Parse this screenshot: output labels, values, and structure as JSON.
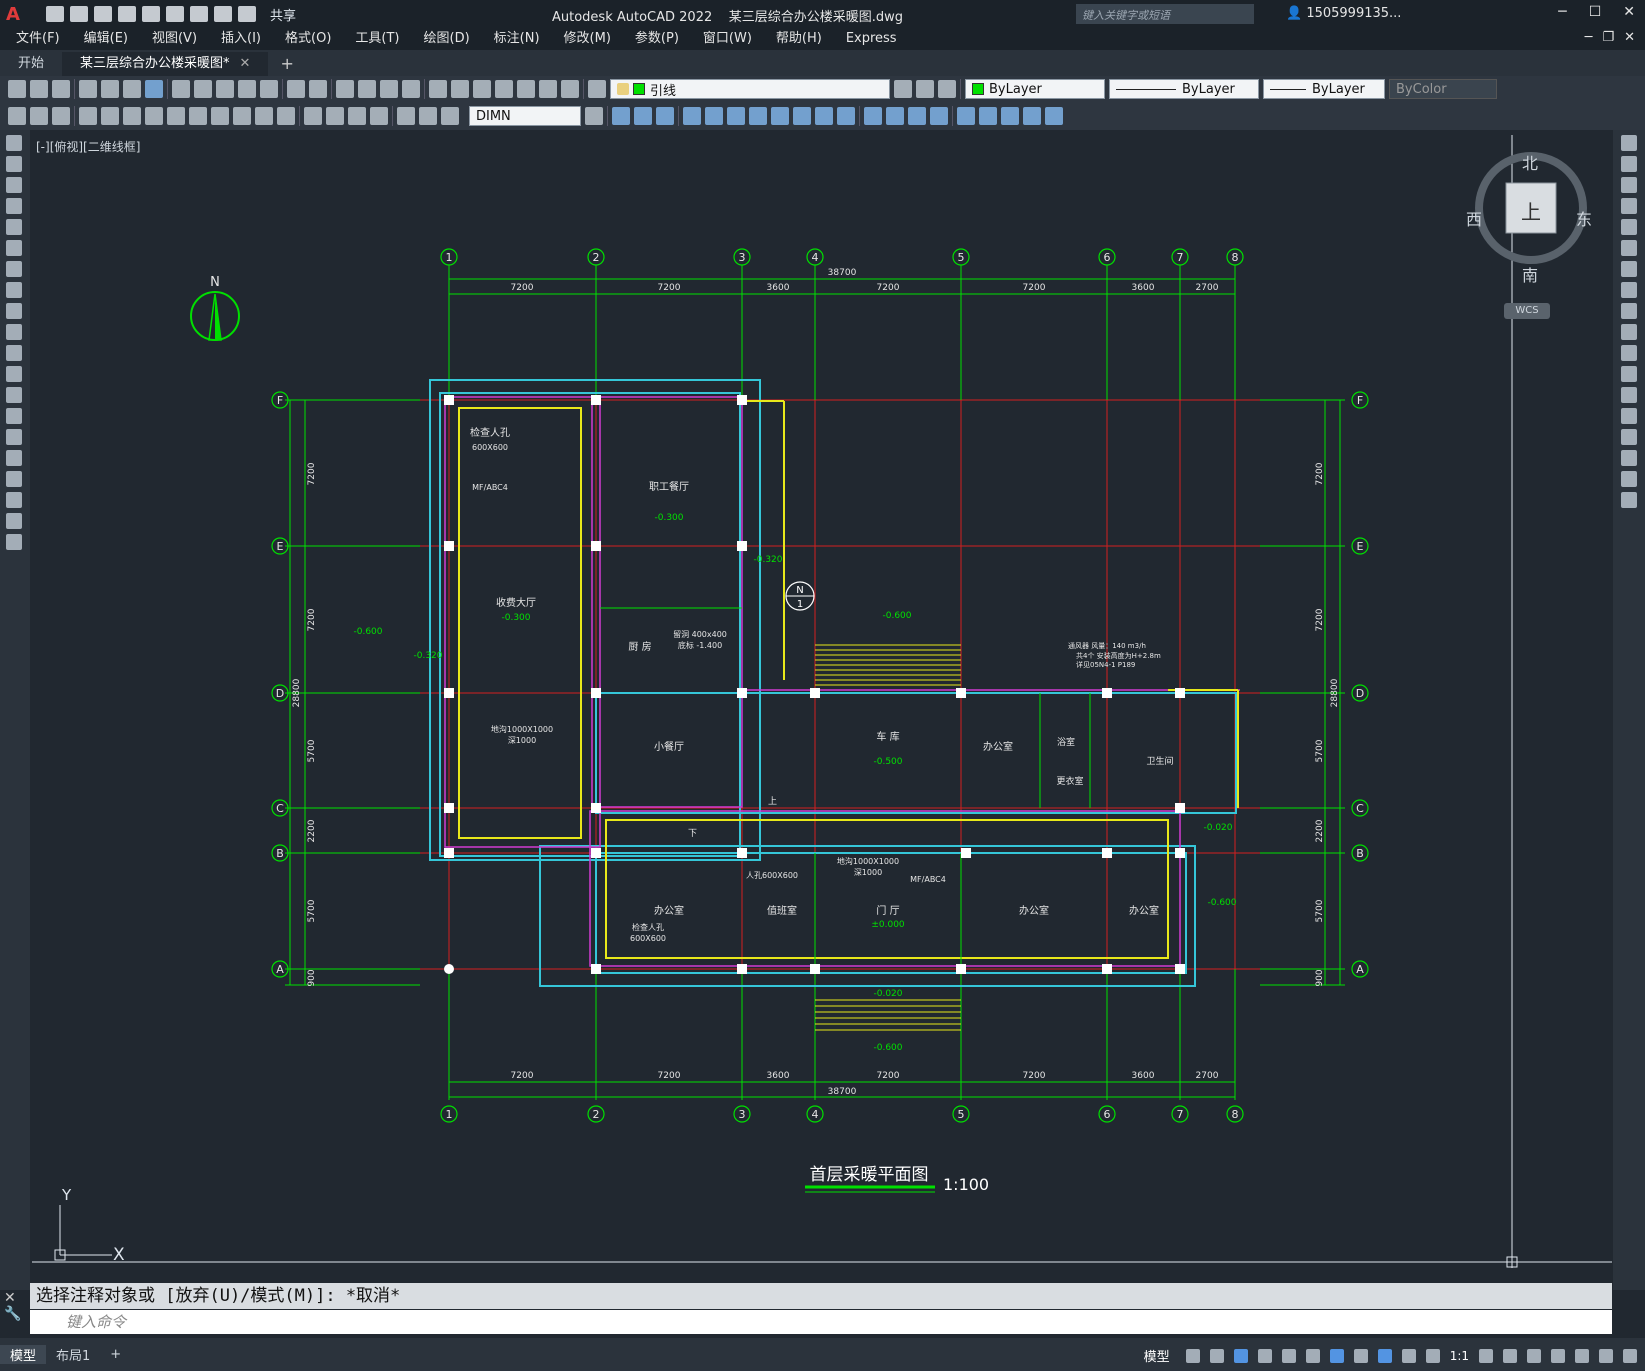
{
  "app": {
    "title": "Autodesk AutoCAD 2022",
    "file": "某三层综合办公楼采暖图.dwg",
    "search_placeholder": "键入关键字或短语",
    "user": "1505999135...",
    "share": "共享"
  },
  "menu": [
    "文件(F)",
    "编辑(E)",
    "视图(V)",
    "插入(I)",
    "格式(O)",
    "工具(T)",
    "绘图(D)",
    "标注(N)",
    "修改(M)",
    "参数(P)",
    "窗口(W)",
    "帮助(H)",
    "Express"
  ],
  "tabs": [
    {
      "label": "开始",
      "active": false
    },
    {
      "label": "某三层综合办公楼采暖图*",
      "active": true
    }
  ],
  "toolbar": {
    "layer": "引线",
    "color": "ByLayer",
    "linetype": "ByLayer",
    "lineweight": "ByLayer",
    "plotstyle": "ByColor",
    "dimstyle": "DIMN"
  },
  "viewport_label": "[-][俯视][二维线框]",
  "viewcube": {
    "north": "北",
    "south": "南",
    "east": "东",
    "west": "西",
    "top": "上",
    "wcs": "WCS"
  },
  "drawing": {
    "title": "首层采暖平面图",
    "scale": "1:100",
    "north_label": "N",
    "axes_x": [
      "1",
      "2",
      "3",
      "4",
      "5",
      "6",
      "7",
      "8"
    ],
    "axes_y": [
      "F",
      "E",
      "D",
      "C",
      "B",
      "A"
    ],
    "dims_top": [
      "7200",
      "7200",
      "3600",
      "7200",
      "7200",
      "3600",
      "2700"
    ],
    "total_width": "38700",
    "dims_side": [
      "7200",
      "7200",
      "5700",
      "2200",
      "5700",
      "900"
    ],
    "total_depth": "28800",
    "rooms": [
      {
        "name": "检查人孔",
        "note": "600X600"
      },
      {
        "name": "MF/ABC4"
      },
      {
        "name": "职工餐厅",
        "level": "-0.300"
      },
      {
        "name": "收费大厅",
        "level": "-0.300"
      },
      {
        "name": "厨  房"
      },
      {
        "name": "留洞 400x400"
      },
      {
        "name": "底标  -1.400"
      },
      {
        "name": "小餐厅"
      },
      {
        "name": "车  库",
        "level": "-0.500"
      },
      {
        "name": "办公室"
      },
      {
        "name": "浴室"
      },
      {
        "name": "更衣室"
      },
      {
        "name": "卫生间"
      },
      {
        "name": "地沟1000X1000",
        "note": "深1000"
      },
      {
        "name": "办公室"
      },
      {
        "name": "值班室"
      },
      {
        "name": "门  厅",
        "level": "±0.000"
      },
      {
        "name": "办公室"
      },
      {
        "name": "办公室"
      },
      {
        "name": "人孔600X600"
      },
      {
        "name": "检查人孔",
        "note": "600X600"
      }
    ],
    "levels": [
      "-0.600",
      "-0.320",
      "-0.320",
      "-0.600",
      "-0.020",
      "-0.600",
      "-0.020",
      "-0.600"
    ],
    "notes": [
      "通风器 风量：140 m3/h",
      "共4个 安装高度为H+2.8m",
      "详见05N4-1 P189"
    ],
    "stair_marks": [
      "上",
      "下"
    ],
    "section_mark": "N",
    "section_num": "1"
  },
  "ucs": {
    "x": "X",
    "y": "Y"
  },
  "command": {
    "history": "选择注释对象或 [放弃(U)/模式(M)]: *取消*",
    "placeholder": "键入命令"
  },
  "status": {
    "tabs": [
      {
        "label": "模型",
        "active": true
      },
      {
        "label": "布局1",
        "active": false
      }
    ],
    "model": "模型",
    "scale": "1:1"
  }
}
